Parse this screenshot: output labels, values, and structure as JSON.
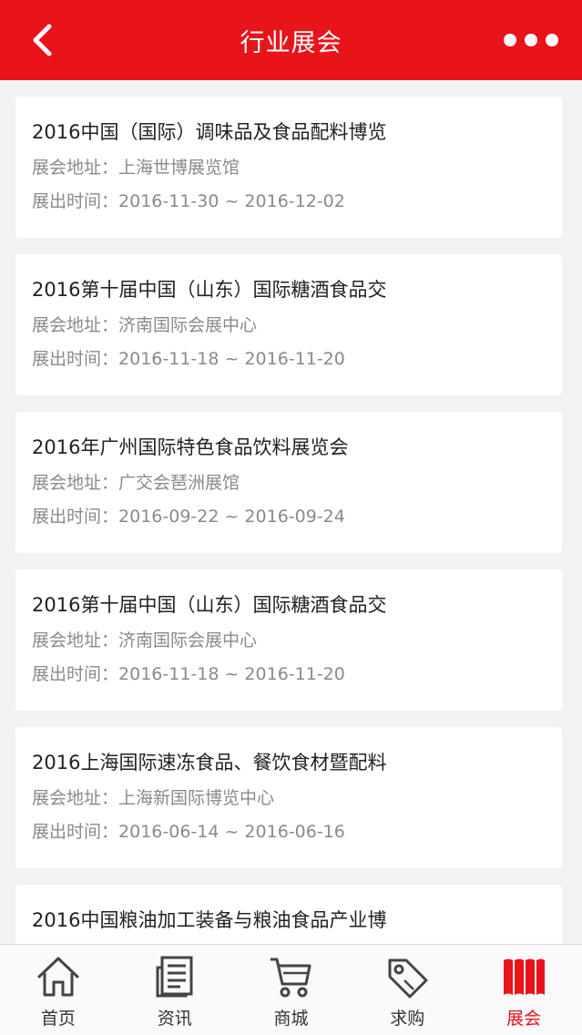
{
  "header": {
    "title": "行业展会",
    "colors": {
      "bar": "#e8141a",
      "text": "#ffffff"
    }
  },
  "labels": {
    "address": "展会地址：",
    "time": "展出时间："
  },
  "exhibitions": [
    {
      "name": "2016中国（国际）调味品及食品配料博览",
      "address": "上海世博展览馆",
      "time": "2016-11-30 ~ 2016-12-02"
    },
    {
      "name": "2016第十届中国（山东）国际糖酒食品交",
      "address": "济南国际会展中心",
      "time": "2016-11-18 ~ 2016-11-20"
    },
    {
      "name": "2016年广州国际特色食品饮料展览会",
      "address": "广交会琶洲展馆",
      "time": "2016-09-22 ~ 2016-09-24"
    },
    {
      "name": "2016第十届中国（山东）国际糖酒食品交",
      "address": "济南国际会展中心",
      "time": "2016-11-18 ~ 2016-11-20"
    },
    {
      "name": "2016上海国际速冻食品、餐饮食材暨配料",
      "address": "上海新国际博览中心",
      "time": "2016-06-14 ~ 2016-06-16"
    },
    {
      "name": "2016中国粮油加工装备与粮油食品产业博",
      "address": "",
      "time": ""
    }
  ],
  "tabbar": {
    "items": [
      {
        "label": "首页",
        "icon": "home-icon",
        "active": false
      },
      {
        "label": "资讯",
        "icon": "news-icon",
        "active": false
      },
      {
        "label": "商城",
        "icon": "cart-icon",
        "active": false
      },
      {
        "label": "求购",
        "icon": "tag-icon",
        "active": false
      },
      {
        "label": "展会",
        "icon": "exhibition-icon",
        "active": true
      }
    ],
    "colors": {
      "active": "#e8141a",
      "inactive": "#333333"
    }
  }
}
